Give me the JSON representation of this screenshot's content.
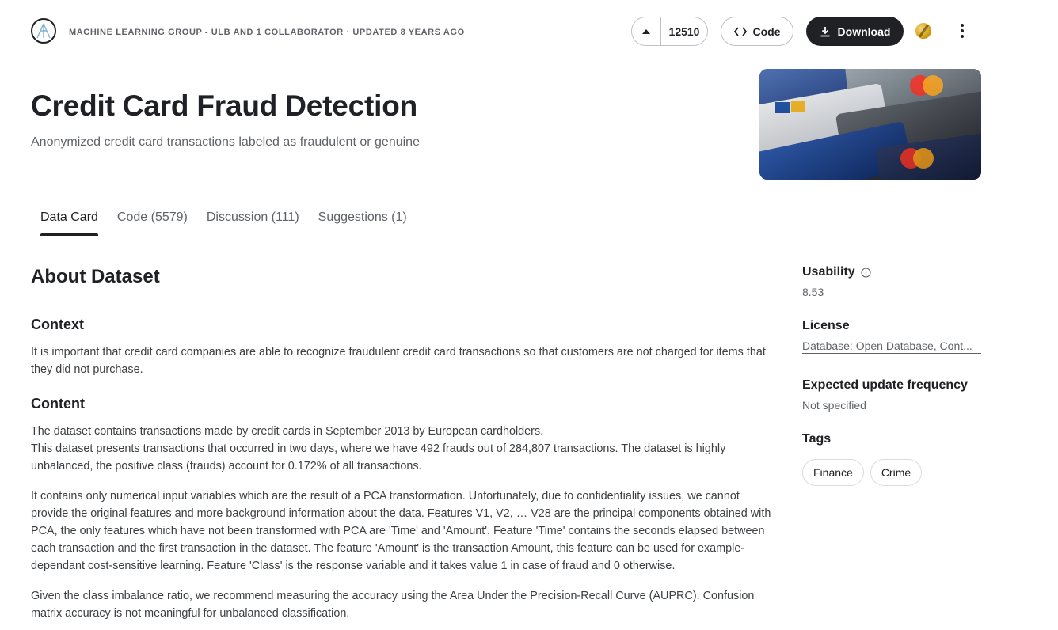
{
  "header": {
    "byline": "MACHINE LEARNING GROUP - ULB AND 1 COLLABORATOR · UPDATED 8 YEARS AGO",
    "upvote_count": "12510",
    "code_label": "Code",
    "download_label": "Download"
  },
  "dataset": {
    "title": "Credit Card Fraud Detection",
    "subtitle": "Anonymized credit card transactions labeled as fraudulent or genuine"
  },
  "tabs": [
    {
      "label": "Data Card",
      "active": true
    },
    {
      "label": "Code (5579)",
      "active": false
    },
    {
      "label": "Discussion (111)",
      "active": false
    },
    {
      "label": "Suggestions (1)",
      "active": false
    }
  ],
  "about": {
    "heading": "About Dataset",
    "context_heading": "Context",
    "context_text": "It is important that credit card companies are able to recognize fraudulent credit card transactions so that customers are not charged for items that they did not purchase.",
    "content_heading": "Content",
    "content_line1": "The dataset contains transactions made by credit cards in September 2013 by European cardholders.",
    "content_line2": "This dataset presents transactions that occurred in two days, where we have 492 frauds out of 284,807 transactions. The dataset is highly unbalanced, the positive class (frauds) account for 0.172% of all transactions.",
    "content_para2": "It contains only numerical input variables which are the result of a PCA transformation. Unfortunately, due to confidentiality issues, we cannot provide the original features and more background information about the data. Features V1, V2, … V28 are the principal components obtained with PCA, the only features which have not been transformed with PCA are 'Time' and 'Amount'. Feature 'Time' contains the seconds elapsed between each transaction and the first transaction in the dataset. The feature 'Amount' is the transaction Amount, this feature can be used for example-dependant cost-sensitive learning. Feature 'Class' is the response variable and it takes value 1 in case of fraud and 0 otherwise.",
    "content_para3": "Given the class imbalance ratio, we recommend measuring the accuracy using the Area Under the Precision-Recall Curve (AUPRC). Confusion matrix accuracy is not meaningful for unbalanced classification."
  },
  "sidebar": {
    "usability_label": "Usability",
    "usability_value": "8.53",
    "license_label": "License",
    "license_value": "Database: Open Database, Cont...",
    "update_label": "Expected update frequency",
    "update_value": "Not specified",
    "tags_label": "Tags",
    "tags": [
      "Finance",
      "Crime"
    ]
  },
  "colors": {
    "accent_dark": "#202124",
    "muted_text": "#5f6368",
    "border": "#dadce0"
  }
}
